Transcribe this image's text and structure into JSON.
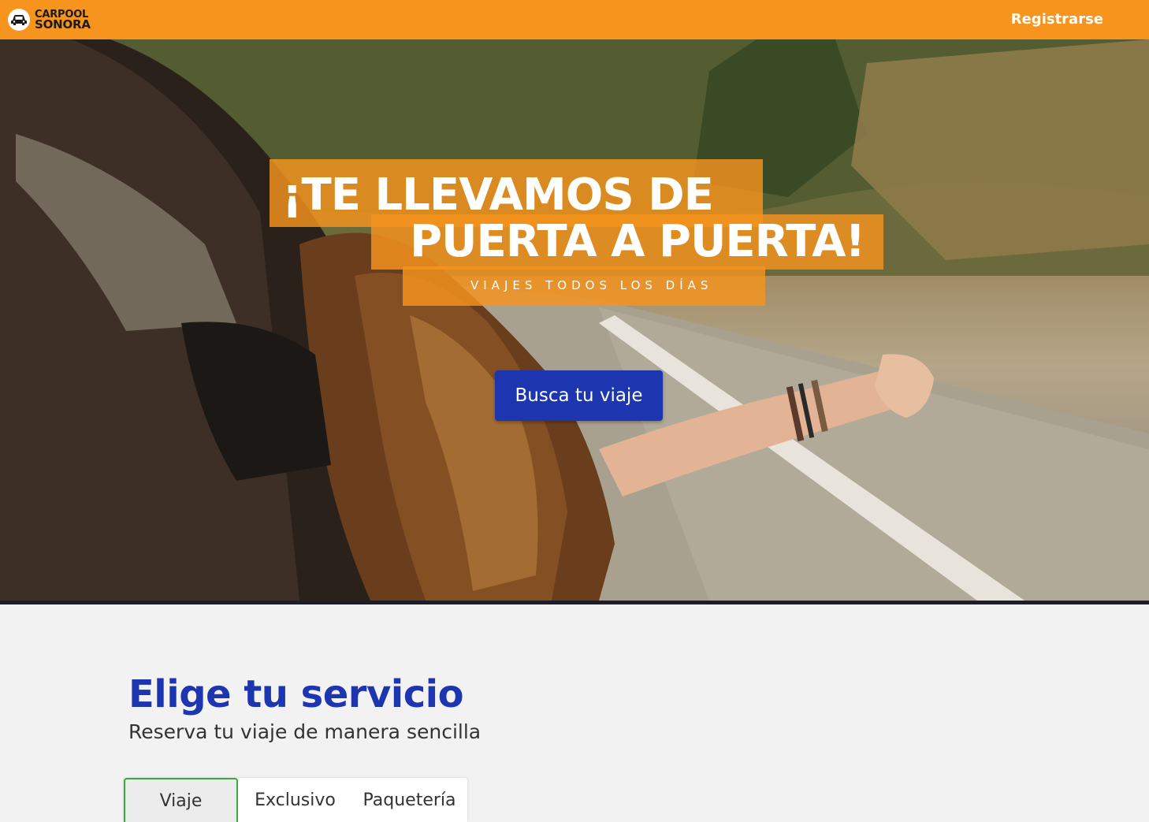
{
  "brand": {
    "name_line1": "CARPOOL",
    "name_line2": "SONORA",
    "logo_icon": "car-icon",
    "primary_color": "#f7941d",
    "accent_color": "#1d36b0"
  },
  "nav": {
    "register_label": "Registrarse"
  },
  "hero": {
    "headline_line1": "¡TE LLEVAMOS DE",
    "headline_line2": "PUERTA A PUERTA!",
    "subheadline": "VIAJES TODOS LOS DÍAS",
    "cta_label": "Busca tu viaje"
  },
  "services": {
    "title": "Elige tu servicio",
    "subtitle": "Reserva tu viaje de manera sencilla",
    "tabs": [
      {
        "label": "Viaje",
        "active": true
      },
      {
        "label": "Exclusivo",
        "active": false
      },
      {
        "label": "Paquetería",
        "active": false
      }
    ]
  }
}
